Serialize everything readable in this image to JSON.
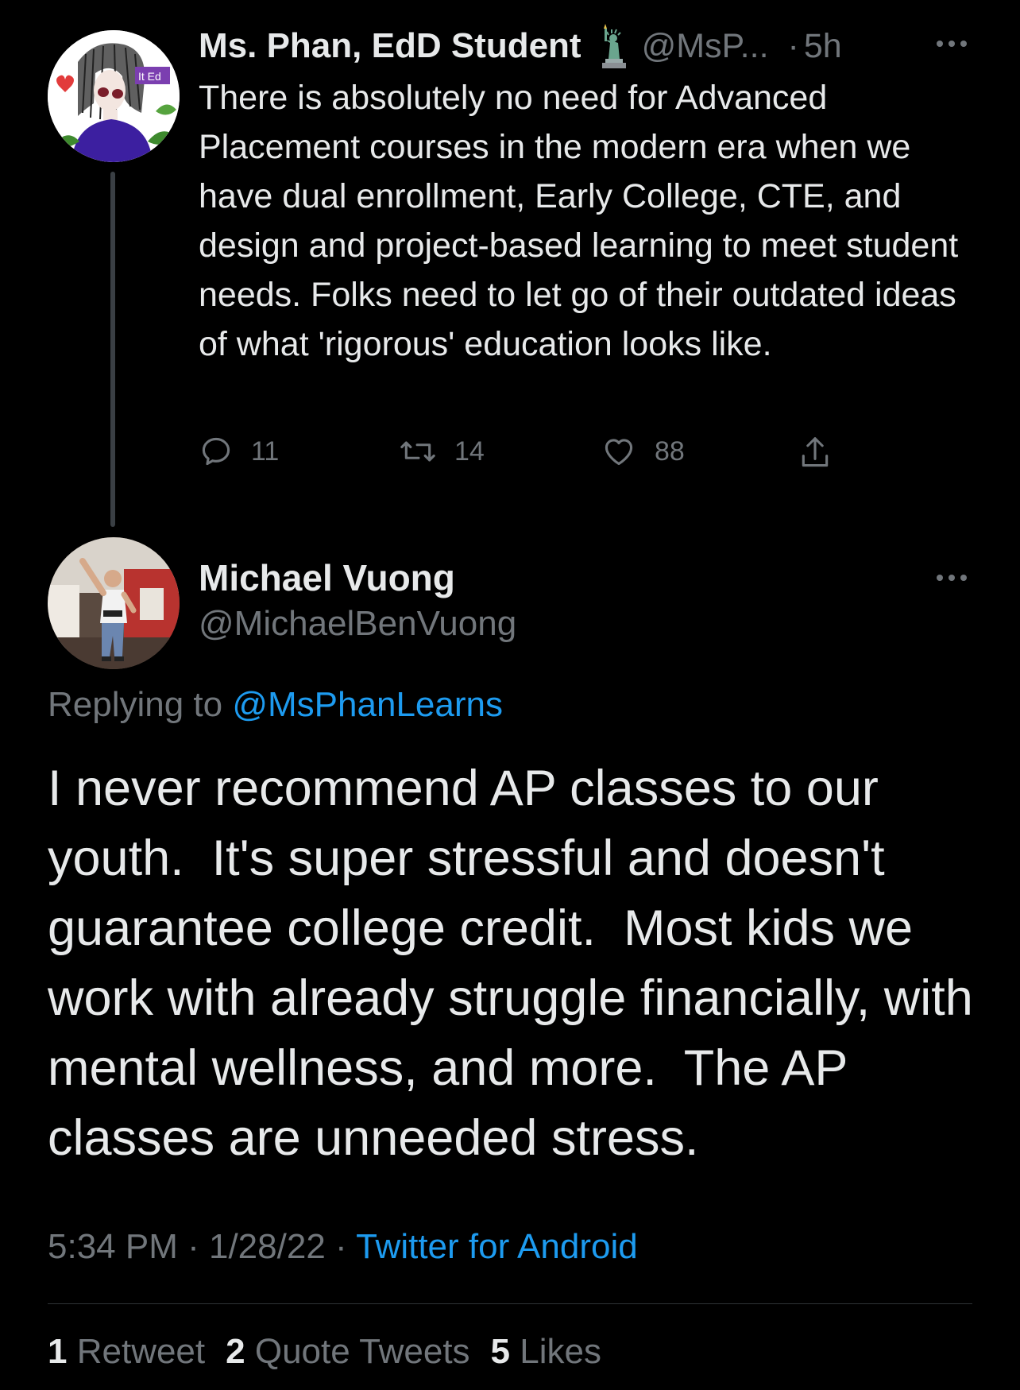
{
  "parent_tweet": {
    "author_name": "Ms. Phan, EdD Student",
    "author_handle": "@MsP...",
    "separator": "·",
    "time_ago": "5h",
    "text": "There is absolutely no need for Advanced Placement courses in the modern era when we have dual enrollment, Early College, CTE, and design and project-based learning to meet student needs. Folks need to let go of their outdated ideas of what 'rigorous' education looks like.",
    "reply_count": "11",
    "retweet_count": "14",
    "like_count": "88",
    "icons": [
      "statue-of-liberty-icon",
      "more-icon",
      "reply-icon",
      "retweet-icon",
      "like-icon",
      "share-icon"
    ]
  },
  "reply_tweet": {
    "author_name": "Michael Vuong",
    "author_handle": "@MichaelBenVuong",
    "replying_prefix": "Replying to ",
    "replying_to": "@MsPhanLearns",
    "text": "I never recommend AP classes to our youth.  It's super stressful and doesn't guarantee college credit.  Most kids we work with already struggle financially, with mental wellness, and more.  The AP classes are unneeded stress.",
    "time": "5:34 PM",
    "separator": " · ",
    "date": "1/28/22",
    "source": "Twitter for Android",
    "stats": {
      "retweets_count": "1",
      "retweets_label": "Retweet",
      "quotes_count": "2",
      "quotes_label": "Quote Tweets",
      "likes_count": "5",
      "likes_label": "Likes"
    }
  },
  "colors": {
    "background": "#000000",
    "text": "#e7e9ea",
    "muted": "#71767b",
    "link": "#1d9bf0"
  }
}
